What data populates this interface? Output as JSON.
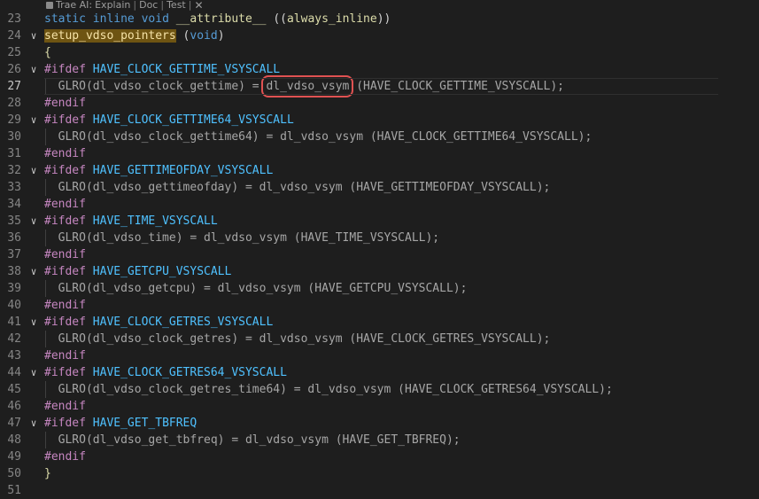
{
  "codelens": {
    "prefix": "Trae AI:",
    "actions": [
      "Explain",
      "Doc",
      "Test"
    ],
    "separator": "|",
    "close_glyph": "✕"
  },
  "lines": [
    {
      "n": "23",
      "tokens": [
        [
          "static",
          "kw"
        ],
        [
          " ",
          "id"
        ],
        [
          "inline",
          "kw"
        ],
        [
          " ",
          "id"
        ],
        [
          "void",
          "kw"
        ],
        [
          " ",
          "id"
        ],
        [
          "__attribute__",
          "fn"
        ],
        [
          " ",
          "id"
        ],
        [
          "((",
          "paren"
        ],
        [
          "always_inline",
          "fn"
        ],
        [
          "))",
          "paren"
        ]
      ]
    },
    {
      "n": "24",
      "fold": true,
      "tokens": [
        [
          "setup_vdso_pointers",
          "fn hl"
        ],
        [
          " ",
          "id"
        ],
        [
          "(",
          "paren"
        ],
        [
          "void",
          "ty"
        ],
        [
          ")",
          "paren"
        ]
      ]
    },
    {
      "n": "25",
      "tokens": [
        [
          "{",
          "fn"
        ]
      ]
    },
    {
      "n": "26",
      "fold": true,
      "tokens": [
        [
          "#ifdef",
          "pp"
        ],
        [
          " ",
          "id"
        ],
        [
          "HAVE_CLOCK_GETTIME_VSYSCALL",
          "mac"
        ]
      ]
    },
    {
      "n": "27",
      "current": true,
      "indent": true,
      "tokens": [
        [
          "  GLRO(dl_vdso_clock_gettime) = ",
          "gray"
        ],
        [
          "dl_vdso_vsym",
          "gray redbox"
        ],
        [
          " (HAVE_CLOCK_GETTIME_VSYSCALL);",
          "gray"
        ]
      ]
    },
    {
      "n": "28",
      "tokens": [
        [
          "#endif",
          "pp"
        ]
      ]
    },
    {
      "n": "29",
      "fold": true,
      "tokens": [
        [
          "#ifdef",
          "pp"
        ],
        [
          " ",
          "id"
        ],
        [
          "HAVE_CLOCK_GETTIME64_VSYSCALL",
          "mac"
        ]
      ]
    },
    {
      "n": "30",
      "indent": true,
      "tokens": [
        [
          "  GLRO(dl_vdso_clock_gettime64) = dl_vdso_vsym (HAVE_CLOCK_GETTIME64_VSYSCALL);",
          "gray"
        ]
      ]
    },
    {
      "n": "31",
      "tokens": [
        [
          "#endif",
          "pp"
        ]
      ]
    },
    {
      "n": "32",
      "fold": true,
      "tokens": [
        [
          "#ifdef",
          "pp"
        ],
        [
          " ",
          "id"
        ],
        [
          "HAVE_GETTIMEOFDAY_VSYSCALL",
          "mac"
        ]
      ]
    },
    {
      "n": "33",
      "indent": true,
      "tokens": [
        [
          "  GLRO(dl_vdso_gettimeofday) = dl_vdso_vsym (HAVE_GETTIMEOFDAY_VSYSCALL);",
          "gray"
        ]
      ]
    },
    {
      "n": "34",
      "tokens": [
        [
          "#endif",
          "pp"
        ]
      ]
    },
    {
      "n": "35",
      "fold": true,
      "tokens": [
        [
          "#ifdef",
          "pp"
        ],
        [
          " ",
          "id"
        ],
        [
          "HAVE_TIME_VSYSCALL",
          "mac"
        ]
      ]
    },
    {
      "n": "36",
      "indent": true,
      "tokens": [
        [
          "  GLRO(dl_vdso_time) = dl_vdso_vsym (HAVE_TIME_VSYSCALL);",
          "gray"
        ]
      ]
    },
    {
      "n": "37",
      "tokens": [
        [
          "#endif",
          "pp"
        ]
      ]
    },
    {
      "n": "38",
      "fold": true,
      "tokens": [
        [
          "#ifdef",
          "pp"
        ],
        [
          " ",
          "id"
        ],
        [
          "HAVE_GETCPU_VSYSCALL",
          "mac"
        ]
      ]
    },
    {
      "n": "39",
      "indent": true,
      "tokens": [
        [
          "  GLRO(dl_vdso_getcpu) = dl_vdso_vsym (HAVE_GETCPU_VSYSCALL);",
          "gray"
        ]
      ]
    },
    {
      "n": "40",
      "tokens": [
        [
          "#endif",
          "pp"
        ]
      ]
    },
    {
      "n": "41",
      "fold": true,
      "tokens": [
        [
          "#ifdef",
          "pp"
        ],
        [
          " ",
          "id"
        ],
        [
          "HAVE_CLOCK_GETRES_VSYSCALL",
          "mac"
        ]
      ]
    },
    {
      "n": "42",
      "indent": true,
      "tokens": [
        [
          "  GLRO(dl_vdso_clock_getres) = dl_vdso_vsym (HAVE_CLOCK_GETRES_VSYSCALL);",
          "gray"
        ]
      ]
    },
    {
      "n": "43",
      "tokens": [
        [
          "#endif",
          "pp"
        ]
      ]
    },
    {
      "n": "44",
      "fold": true,
      "tokens": [
        [
          "#ifdef",
          "pp"
        ],
        [
          " ",
          "id"
        ],
        [
          "HAVE_CLOCK_GETRES64_VSYSCALL",
          "mac"
        ]
      ]
    },
    {
      "n": "45",
      "indent": true,
      "tokens": [
        [
          "  GLRO(dl_vdso_clock_getres_time64) = dl_vdso_vsym (HAVE_CLOCK_GETRES64_VSYSCALL);",
          "gray"
        ]
      ]
    },
    {
      "n": "46",
      "tokens": [
        [
          "#endif",
          "pp"
        ]
      ]
    },
    {
      "n": "47",
      "fold": true,
      "tokens": [
        [
          "#ifdef",
          "pp"
        ],
        [
          " ",
          "id"
        ],
        [
          "HAVE_GET_TBFREQ",
          "mac"
        ]
      ]
    },
    {
      "n": "48",
      "indent": true,
      "tokens": [
        [
          "  GLRO(dl_vdso_get_tbfreq) = dl_vdso_vsym (HAVE_GET_TBFREQ);",
          "gray"
        ]
      ]
    },
    {
      "n": "49",
      "tokens": [
        [
          "#endif",
          "pp"
        ]
      ]
    },
    {
      "n": "50",
      "tokens": [
        [
          "}",
          "fn"
        ]
      ]
    },
    {
      "n": "51",
      "tokens": []
    }
  ]
}
